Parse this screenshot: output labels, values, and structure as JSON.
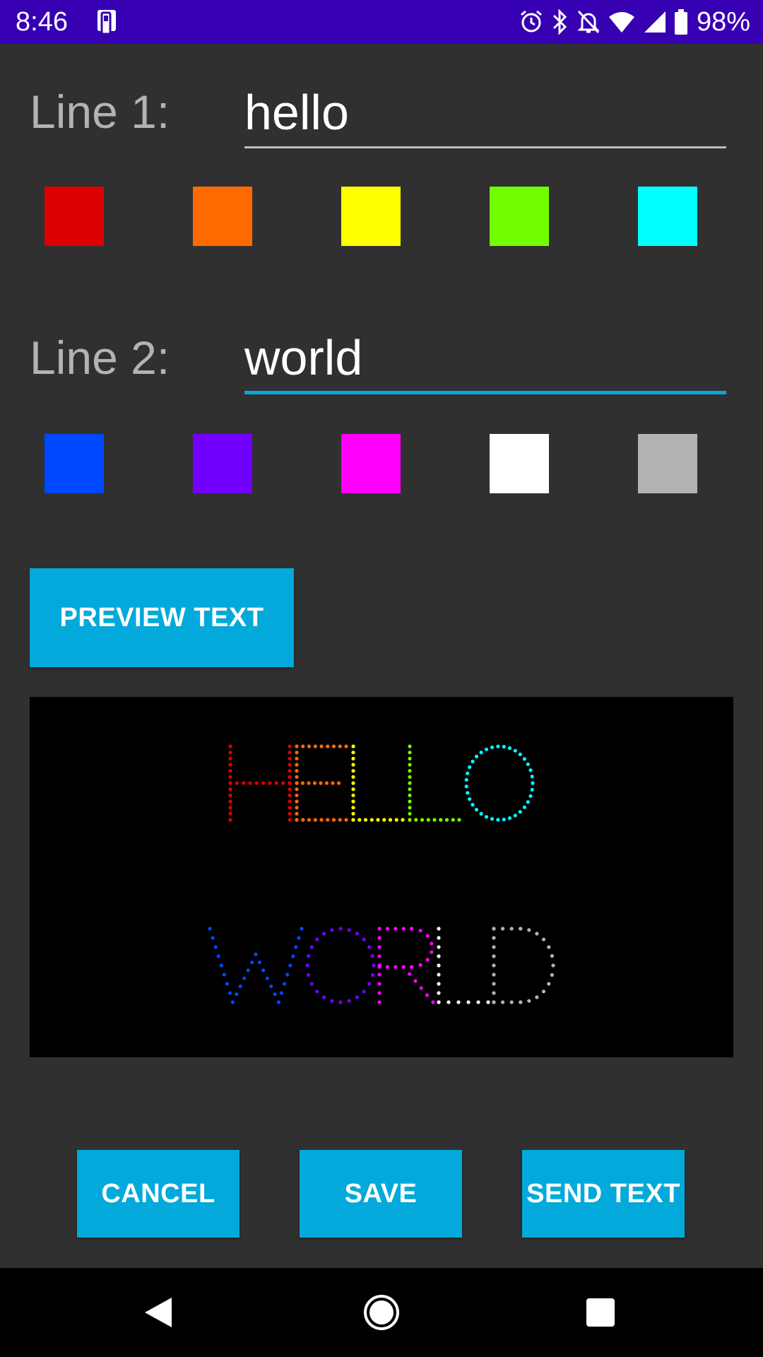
{
  "status_bar": {
    "time": "8:46",
    "battery": "98%",
    "bg_color": "#3700b3"
  },
  "line1": {
    "label": "Line 1:",
    "value": "hello",
    "colors": [
      "#dd0000",
      "#ff6a00",
      "#ffff00",
      "#72ff00",
      "#00ffff"
    ]
  },
  "line2": {
    "label": "Line 2:",
    "value": "world",
    "colors": [
      "#0048ff",
      "#7200ff",
      "#ff00ff",
      "#ffffff",
      "#b3b3b3"
    ]
  },
  "buttons": {
    "preview": "PREVIEW TEXT",
    "cancel": "CANCEL",
    "save": "SAVE",
    "send": "SEND TEXT"
  },
  "preview": {
    "line1_text": "HELLO",
    "line2_text": "WORLD",
    "line1_letter_colors": [
      "#dd0000",
      "#ff6a00",
      "#ffff00",
      "#72ff00",
      "#00ffff"
    ],
    "line2_letter_colors": [
      "#0048ff",
      "#7200ff",
      "#ff00ff",
      "#ffffff",
      "#b3b3b3"
    ]
  },
  "nav": {
    "back_icon": "back-triangle",
    "home_icon": "home-circle",
    "recents_icon": "recents-square"
  },
  "accent_color": "#03a9da"
}
